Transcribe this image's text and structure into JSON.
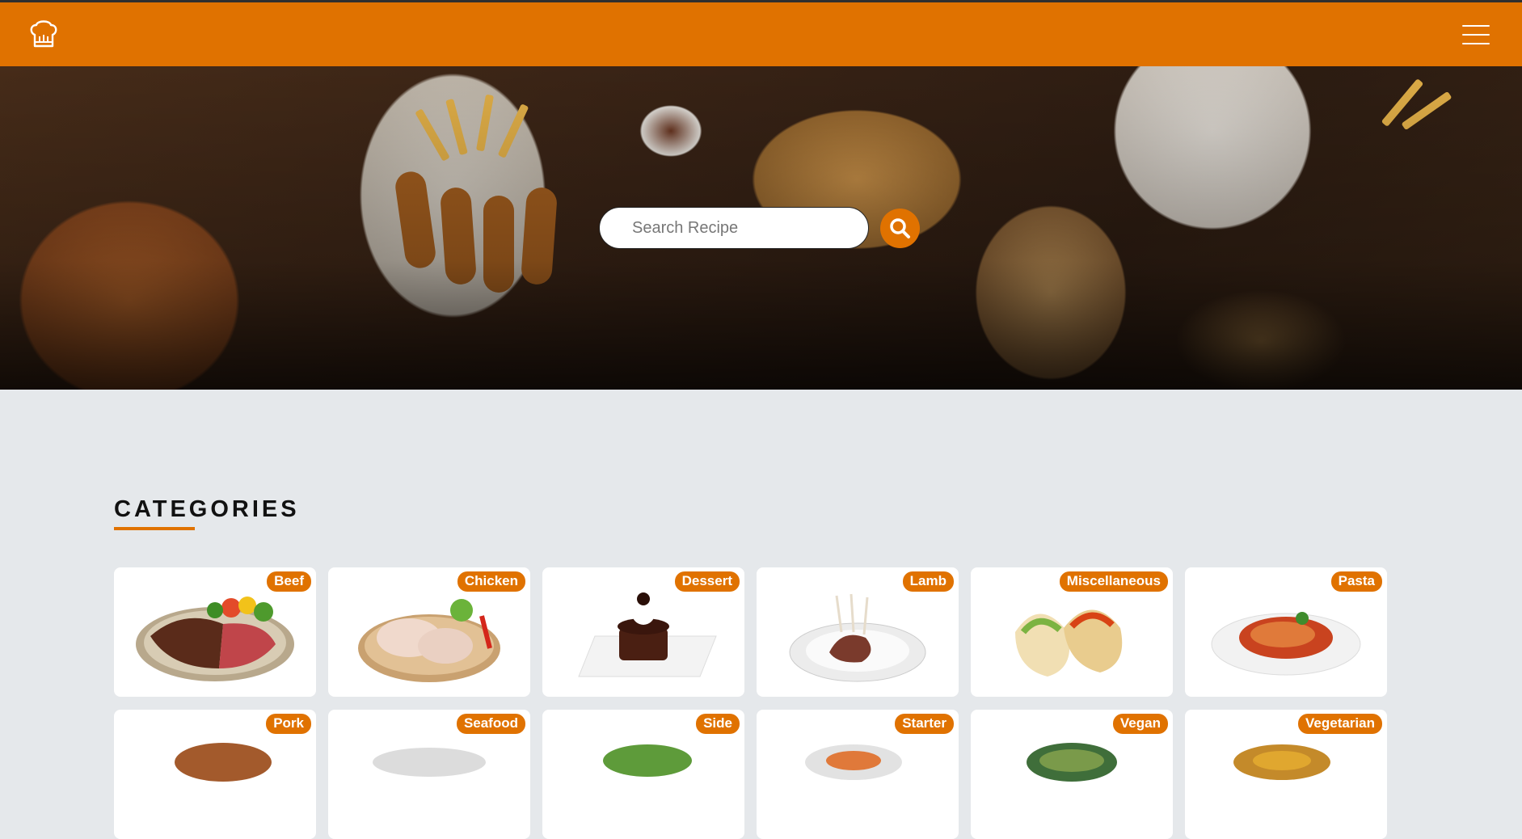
{
  "search": {
    "placeholder": "Search Recipe"
  },
  "section": {
    "title": "CATEGORIES"
  },
  "categories": [
    {
      "label": "Beef",
      "icon": "steak-image"
    },
    {
      "label": "Chicken",
      "icon": "chicken-legs-image"
    },
    {
      "label": "Dessert",
      "icon": "chocolate-cake-image"
    },
    {
      "label": "Lamb",
      "icon": "lamb-chops-image"
    },
    {
      "label": "Miscellaneous",
      "icon": "tacos-image"
    },
    {
      "label": "Pasta",
      "icon": "penne-pasta-image"
    },
    {
      "label": "Pork",
      "icon": "pork-image"
    },
    {
      "label": "Seafood",
      "icon": "seafood-image"
    },
    {
      "label": "Side",
      "icon": "side-dish-image"
    },
    {
      "label": "Starter",
      "icon": "starter-image"
    },
    {
      "label": "Vegan",
      "icon": "vegan-bowl-image"
    },
    {
      "label": "Vegetarian",
      "icon": "vegetarian-image"
    }
  ],
  "colors": {
    "brand": "#e07200",
    "background": "#e5e8eb",
    "topline": "#2f2f2f"
  }
}
